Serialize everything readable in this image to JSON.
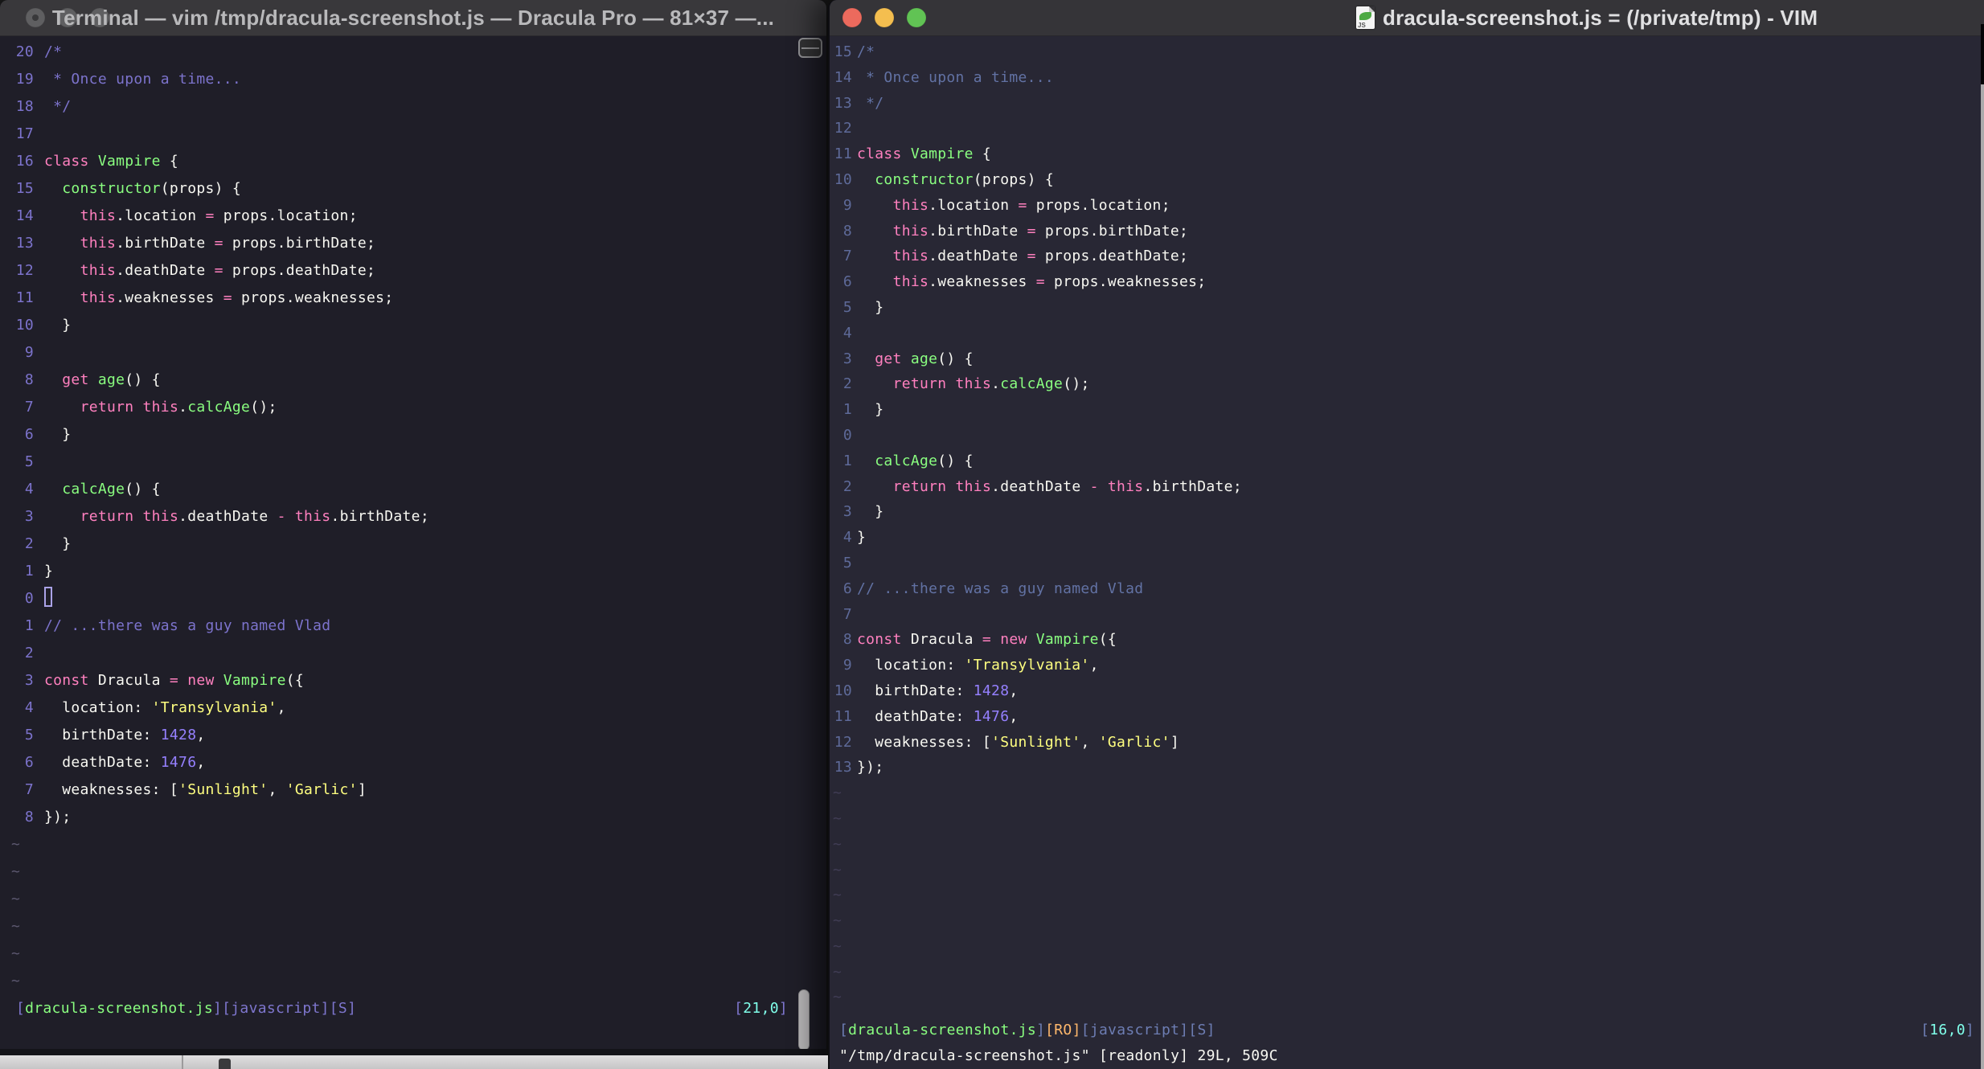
{
  "colors": {
    "bg_left": "#1F1E28",
    "bg_right": "#282734",
    "titlebar_left": "#39383B",
    "titlebar_right": "#353438",
    "title_text_left": "#B9B9BB",
    "title_text_right": "#E0E0E2",
    "fg": "#F8F8F2",
    "pink": "#FF80BF",
    "green": "#8AFF80",
    "yellow": "#FFFF80",
    "purple": "#9580FF",
    "cyan": "#80FFEA",
    "orange": "#FFB86C",
    "comment_left": "#7C73CC",
    "comment_right": "#6272A4",
    "linenr_left": "#7C73CC",
    "linenr_right": "#5E6A99",
    "tilde_left": "#5C5870",
    "tilde_right": "#413D55",
    "status_accent_left": "#7E76CE",
    "status_accent_right": "#6D7DB3",
    "light_red": "#EC6A5D",
    "light_yellow": "#F4BE4F",
    "light_green": "#61C354",
    "light_gray": "#5F5F61"
  },
  "code_lines": [
    [
      [
        "c",
        "/*"
      ]
    ],
    [
      [
        "c",
        " * Once upon a time..."
      ]
    ],
    [
      [
        "c",
        " */"
      ]
    ],
    [],
    [
      [
        "k",
        "class"
      ],
      [
        "t",
        " "
      ],
      [
        "g",
        "Vampire"
      ],
      [
        "t",
        " {"
      ]
    ],
    [
      [
        "t",
        "  "
      ],
      [
        "g",
        "constructor"
      ],
      [
        "t",
        "(props) {"
      ]
    ],
    [
      [
        "t",
        "    "
      ],
      [
        "k",
        "this"
      ],
      [
        "t",
        ".location "
      ],
      [
        "o",
        "="
      ],
      [
        "t",
        " props.location;"
      ]
    ],
    [
      [
        "t",
        "    "
      ],
      [
        "k",
        "this"
      ],
      [
        "t",
        ".birthDate "
      ],
      [
        "o",
        "="
      ],
      [
        "t",
        " props.birthDate;"
      ]
    ],
    [
      [
        "t",
        "    "
      ],
      [
        "k",
        "this"
      ],
      [
        "t",
        ".deathDate "
      ],
      [
        "o",
        "="
      ],
      [
        "t",
        " props.deathDate;"
      ]
    ],
    [
      [
        "t",
        "    "
      ],
      [
        "k",
        "this"
      ],
      [
        "t",
        ".weaknesses "
      ],
      [
        "o",
        "="
      ],
      [
        "t",
        " props.weaknesses;"
      ]
    ],
    [
      [
        "t",
        "  }"
      ]
    ],
    [],
    [
      [
        "t",
        "  "
      ],
      [
        "k",
        "get"
      ],
      [
        "t",
        " "
      ],
      [
        "g",
        "age"
      ],
      [
        "t",
        "() {"
      ]
    ],
    [
      [
        "t",
        "    "
      ],
      [
        "k",
        "return"
      ],
      [
        "t",
        " "
      ],
      [
        "k",
        "this"
      ],
      [
        "t",
        "."
      ],
      [
        "g",
        "calcAge"
      ],
      [
        "t",
        "();"
      ]
    ],
    [
      [
        "t",
        "  }"
      ]
    ],
    [],
    [
      [
        "t",
        "  "
      ],
      [
        "g",
        "calcAge"
      ],
      [
        "t",
        "() {"
      ]
    ],
    [
      [
        "t",
        "    "
      ],
      [
        "k",
        "return"
      ],
      [
        "t",
        " "
      ],
      [
        "k",
        "this"
      ],
      [
        "t",
        ".deathDate "
      ],
      [
        "o",
        "-"
      ],
      [
        "t",
        " "
      ],
      [
        "k",
        "this"
      ],
      [
        "t",
        ".birthDate;"
      ]
    ],
    [
      [
        "t",
        "  }"
      ]
    ],
    [
      [
        "t",
        "}"
      ]
    ],
    [],
    [
      [
        "c",
        "// ...there was a guy named Vlad"
      ]
    ],
    [],
    [
      [
        "k",
        "const"
      ],
      [
        "t",
        " Dracula "
      ],
      [
        "o",
        "="
      ],
      [
        "t",
        " "
      ],
      [
        "k",
        "new"
      ],
      [
        "t",
        " "
      ],
      [
        "g",
        "Vampire"
      ],
      [
        "t",
        "({"
      ]
    ],
    [
      [
        "t",
        "  location: "
      ],
      [
        "s",
        "'Transylvania'"
      ],
      [
        "t",
        ","
      ]
    ],
    [
      [
        "t",
        "  birthDate: "
      ],
      [
        "n",
        "1428"
      ],
      [
        "t",
        ","
      ]
    ],
    [
      [
        "t",
        "  deathDate: "
      ],
      [
        "n",
        "1476"
      ],
      [
        "t",
        ","
      ]
    ],
    [
      [
        "t",
        "  weaknesses: ["
      ],
      [
        "s",
        "'Sunlight'"
      ],
      [
        "t",
        ", "
      ],
      [
        "s",
        "'Garlic'"
      ],
      [
        "t",
        "]"
      ]
    ],
    [
      [
        "t",
        "});"
      ]
    ]
  ],
  "left_window": {
    "title": "Terminal — vim /tmp/dracula-screenshot.js — Dracula Pro — 81×37 —...",
    "numbers": [
      "20",
      "19",
      "18",
      "17",
      "16",
      "15",
      "14",
      "13",
      "12",
      "11",
      "10",
      "9",
      "8",
      "7",
      "6",
      "5",
      "4",
      "3",
      "2",
      "1",
      "0",
      "1",
      "2",
      "3",
      "4",
      "5",
      "6",
      "7",
      "8"
    ],
    "cursor_index": 20,
    "cursor_visible": true,
    "tilde_count": 6,
    "push_status_bottom": false,
    "status_rows": [
      {
        "left": [
          [
            "sb",
            "["
          ],
          [
            "sg",
            "dracula-screenshot.js"
          ],
          [
            "sb",
            "][javascript][S]"
          ]
        ],
        "right": [
          [
            "sb",
            "["
          ],
          [
            "sc",
            "21,0"
          ],
          [
            "sb",
            "]"
          ]
        ]
      }
    ]
  },
  "right_window": {
    "title": "dracula-screenshot.js = (/private/tmp) - VIM",
    "icon": "js-document-icon",
    "numbers": [
      "15",
      "14",
      "13",
      "12",
      "11",
      "10",
      "9",
      "8",
      "7",
      "6",
      "5",
      "4",
      "3",
      "2",
      "1",
      "0",
      "1",
      "2",
      "3",
      "4",
      "5",
      "6",
      "7",
      "8",
      "9",
      "10",
      "11",
      "12",
      "13"
    ],
    "cursor_index": 15,
    "cursor_visible": false,
    "tilde_count": 9,
    "push_status_bottom": true,
    "status_rows": [
      {
        "left": [
          [
            "sb",
            "["
          ],
          [
            "sg",
            "dracula-screenshot.js"
          ],
          [
            "sb",
            "]"
          ],
          [
            "so",
            "[RO]"
          ],
          [
            "sb",
            "[javascript][S]"
          ]
        ],
        "right": [
          [
            "sb",
            "["
          ],
          [
            "sc",
            "16,0"
          ],
          [
            "sb",
            "]"
          ]
        ]
      },
      {
        "left": [
          [
            "sp",
            "\"/tmp/dracula-screenshot.js\" [readonly] 29L, 509C"
          ]
        ],
        "right": []
      }
    ]
  }
}
